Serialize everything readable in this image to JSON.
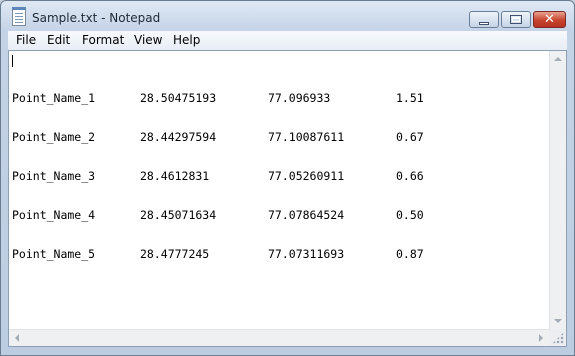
{
  "window": {
    "title": "Sample.txt - Notepad",
    "caption_close": "✕"
  },
  "menu": {
    "items": [
      "File",
      "Edit",
      "Format",
      "View",
      "Help"
    ]
  },
  "document": {
    "rows": [
      [
        "Point_Name_1",
        "28.50475193",
        "77.096933",
        "1.51"
      ],
      [
        "Point_Name_2",
        "28.44297594",
        "77.10087611",
        "0.67"
      ],
      [
        "Point_Name_3",
        "28.4612831",
        "77.05260911",
        "0.66"
      ],
      [
        "Point_Name_4",
        "28.45071634",
        "77.07864524",
        "0.50"
      ],
      [
        "Point_Name_5",
        "28.4777245",
        "77.07311693",
        "0.87"
      ]
    ]
  },
  "colors": {
    "frame": "#bccde1",
    "close_button": "#c7452f"
  },
  "icons": {
    "app": "notepad-icon",
    "minimize": "minimize-icon",
    "maximize": "maximize-icon",
    "close": "close-icon"
  }
}
